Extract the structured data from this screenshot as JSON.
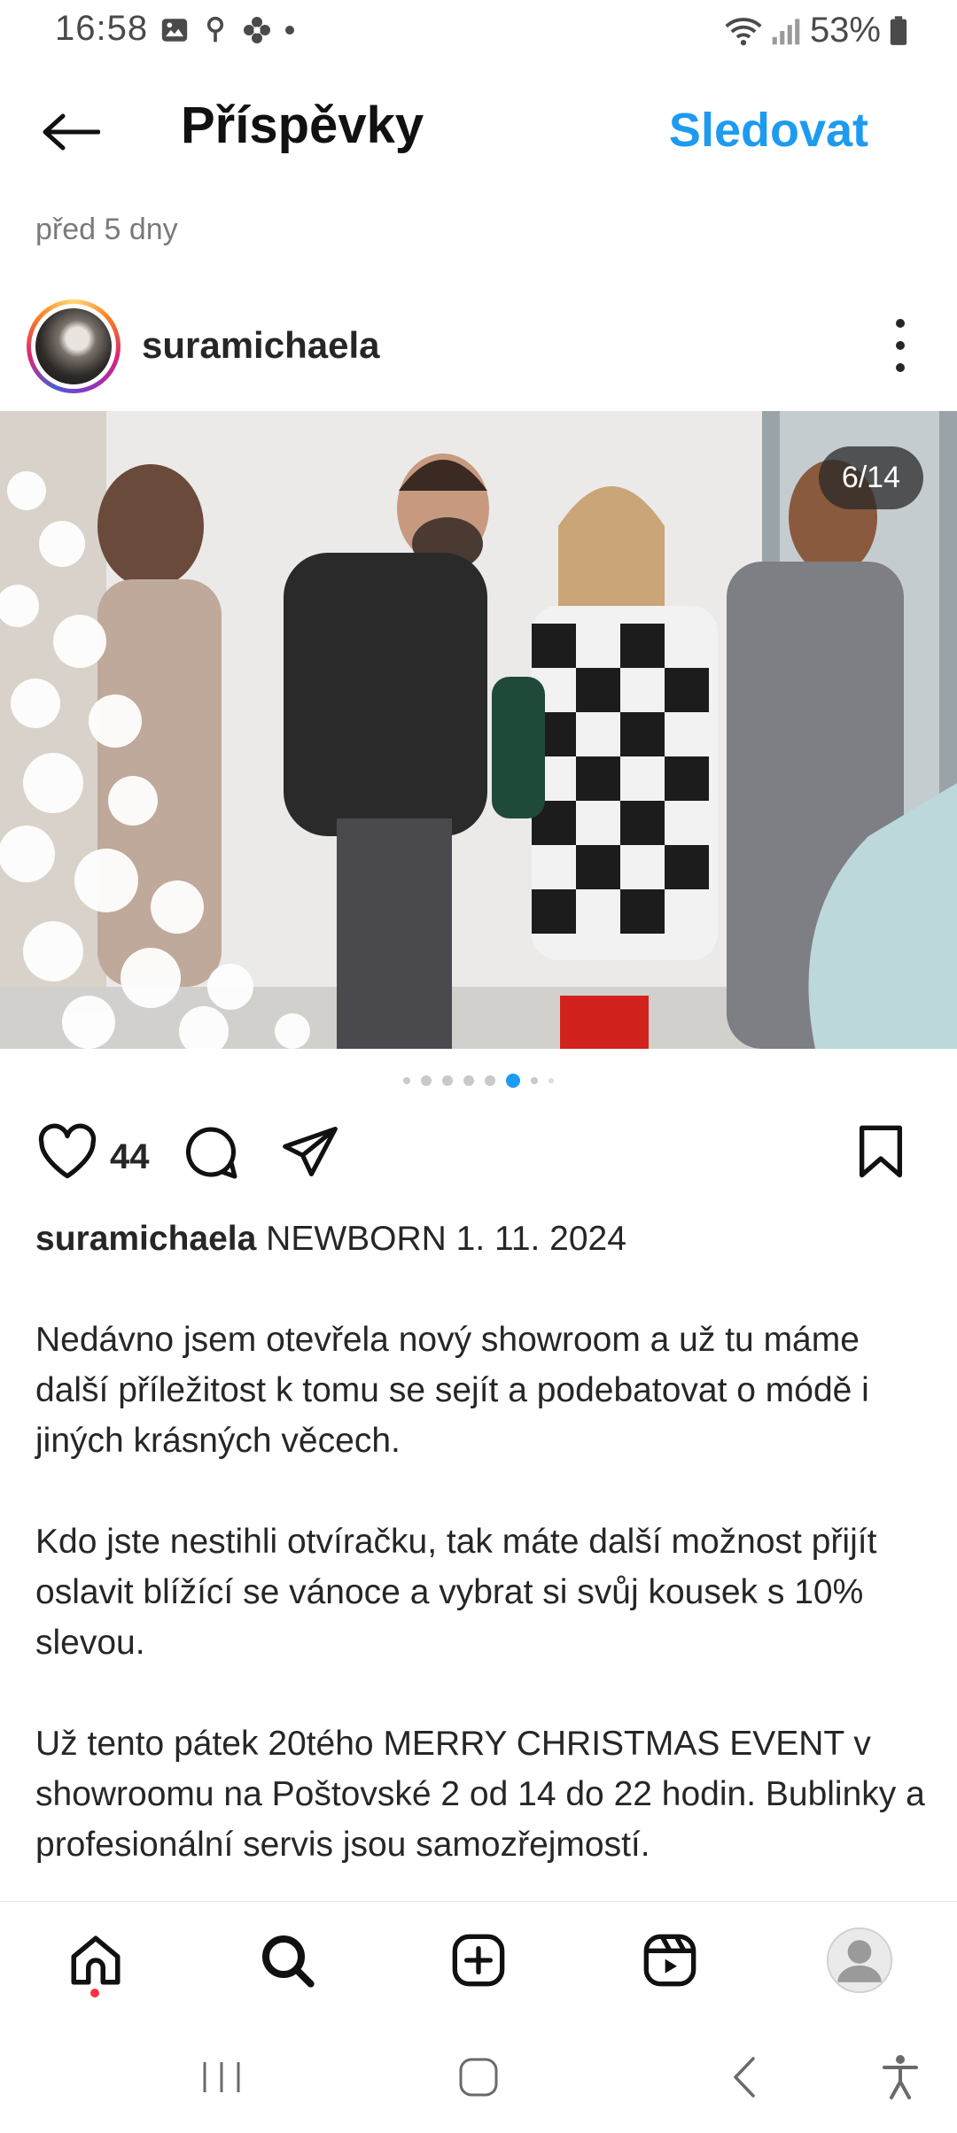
{
  "status_bar": {
    "time": "16:58",
    "battery": "53%"
  },
  "header": {
    "title": "Příspěvky",
    "follow_label": "Sledovat"
  },
  "post": {
    "time_ago": "před 5 dny",
    "username": "suramichaela",
    "image_counter": "6/14",
    "carousel_total_dots": 8,
    "carousel_active_index": 5,
    "like_count": "44",
    "caption_user": "suramichaela",
    "caption_first_line": "NEWBORN 1. 11. 2024",
    "caption_paragraphs": [
      "Nedávno jsem otevřela nový showroom a už tu máme další příležitost k tomu se sejít a podebatovat o módě i jiných krásných věcech.",
      "Kdo jste nestihli otvíračku, tak máte další možnost přijít oslavit blížící se vánoce a vybrat si svůj kousek s 10% slevou.",
      "Už tento pátek 20tého MERRY CHRISTMAS EVENT v showroomu na Poštovské 2 od 14 do 22 hodin. Bublinky a profesionální servis jsou samozřejmostí."
    ]
  },
  "icons": {
    "back": "arrow-left-icon",
    "more": "more-vertical-icon",
    "like": "heart-icon",
    "comment": "comment-icon",
    "share": "send-icon",
    "save": "bookmark-icon",
    "nav": [
      "home-icon",
      "search-icon",
      "add-post-icon",
      "reels-icon",
      "profile-icon"
    ],
    "system": [
      "recents-icon",
      "home-system-icon",
      "back-system-icon",
      "accessibility-icon"
    ]
  },
  "colors": {
    "accent": "#1d9bf0",
    "notification": "#ff3040",
    "text": "#262626"
  }
}
